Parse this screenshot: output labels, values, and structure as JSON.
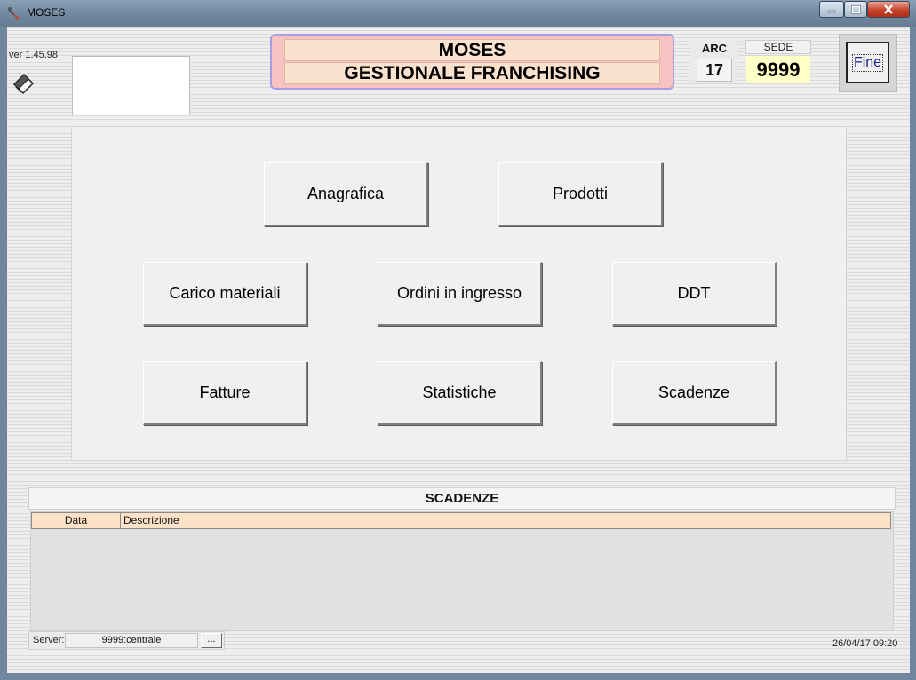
{
  "window": {
    "title": "MOSES",
    "controls": {
      "minimize": "minimize-icon",
      "maximize": "maximize-icon",
      "close": "close-icon"
    }
  },
  "app": {
    "version": "ver 1.45.98",
    "header_line1": "MOSES",
    "header_line2": "GESTIONALE FRANCHISING",
    "arc_label": "ARC",
    "arc_value": "17",
    "sede_label": "SEDE",
    "sede_value": "9999",
    "fine_label": "Fine"
  },
  "menu": {
    "anagrafica": "Anagrafica",
    "prodotti": "Prodotti",
    "carico_materiali": "Carico materiali",
    "ordini_ingresso": "Ordini in ingresso",
    "ddt": "DDT",
    "fatture": "Fatture",
    "statistiche": "Statistiche",
    "scadenze": "Scadenze"
  },
  "scadenze": {
    "title": "SCADENZE",
    "columns": [
      "Data",
      "Descrizione"
    ],
    "rows": []
  },
  "status": {
    "server_label": "Server:",
    "server_value": "9999:centrale",
    "browse_label": "...",
    "datetime": "26/04/17 09:20"
  },
  "colors": {
    "header_bg": "#f8c2c2",
    "header_border": "#a59fe6",
    "header_line_bg": "#fbe2cf",
    "sede_bg": "#ffffc8",
    "table_header_bg": "#fde2c7",
    "fine_text": "#1c1c8a"
  }
}
